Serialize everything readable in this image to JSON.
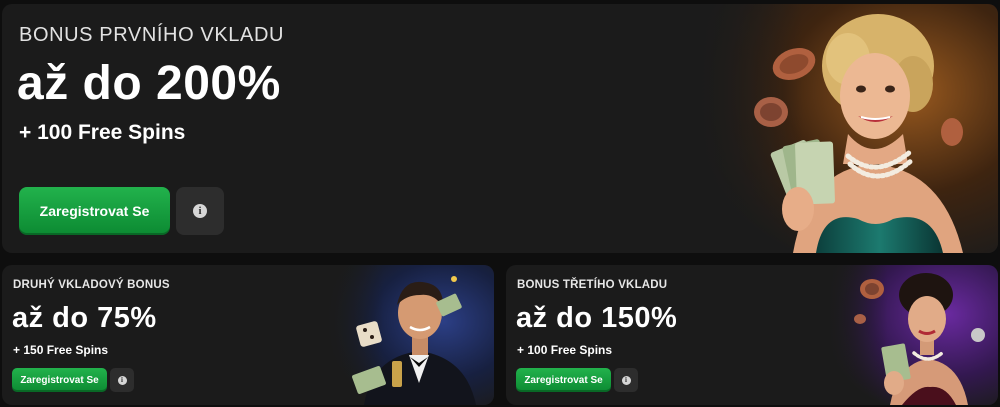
{
  "main_card": {
    "eyebrow": "BONUS PRVNÍHO VKLADU",
    "headline": "až do 200%",
    "spins": "+ 100 Free Spins",
    "register_label": "Zaregistrovat Se",
    "info_label": "i"
  },
  "second_card": {
    "eyebrow": "DRUHÝ VKLADOVÝ BONUS",
    "headline": "až do 75%",
    "spins": "+ 150 Free Spins",
    "register_label": "Zaregistrovat Se",
    "info_label": "i"
  },
  "third_card": {
    "eyebrow": "BONUS TŘETÍHO VKLADU",
    "headline": "až do 150%",
    "spins": "+ 100 Free Spins",
    "register_label": "Zaregistrovat Se",
    "info_label": "i"
  },
  "colors": {
    "background": "#0e0e0e",
    "card": "#1b1b1b",
    "accent_green": "#1aa444",
    "info_button": "#2d2d2d"
  },
  "icons": {
    "info": "info-icon"
  }
}
